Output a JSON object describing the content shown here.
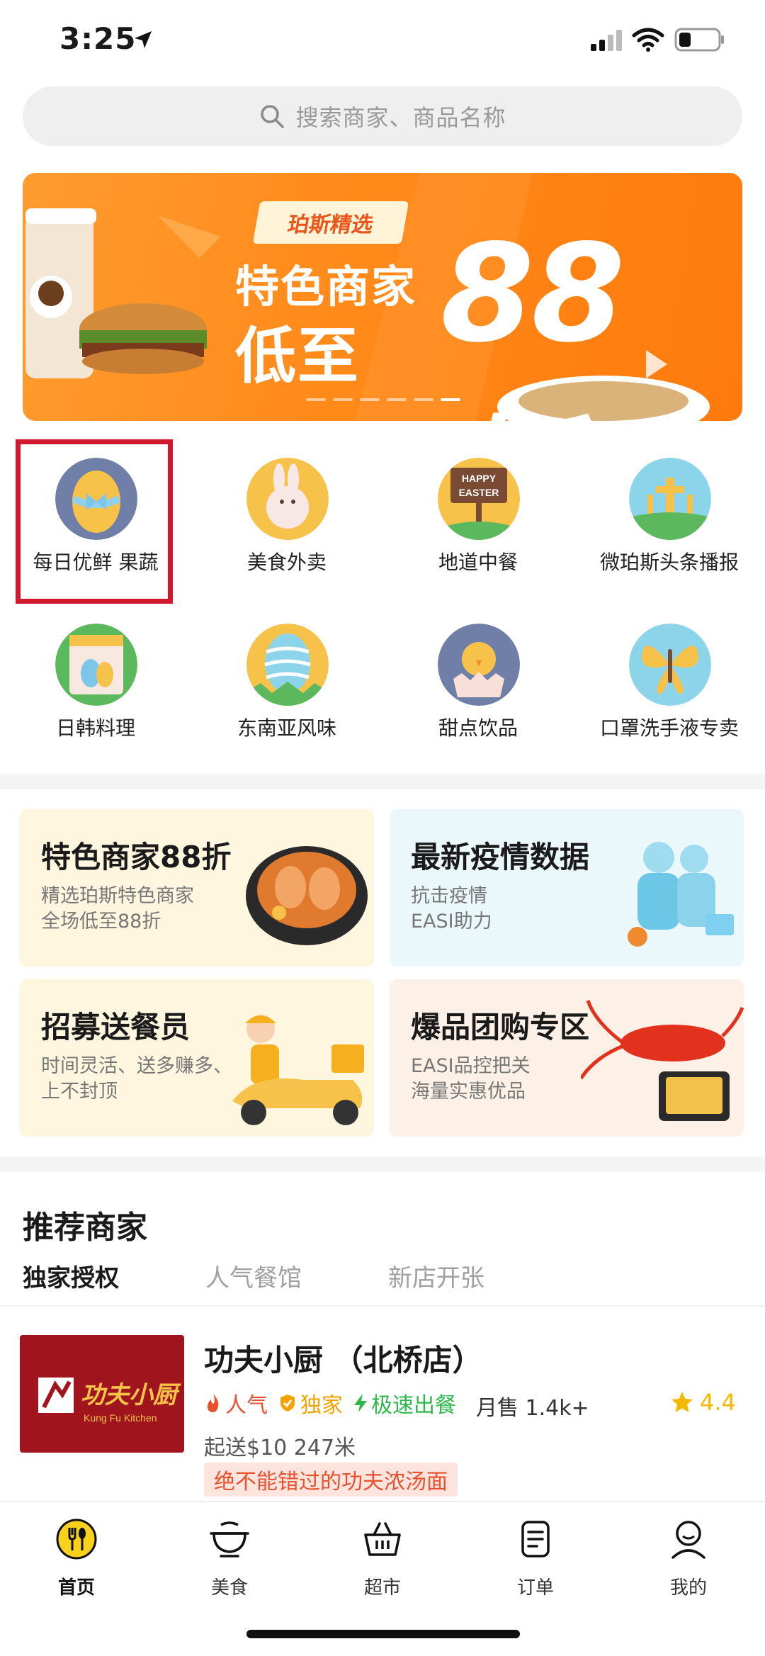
{
  "status_bar": {
    "time": "3:25"
  },
  "search": {
    "placeholder": "搜索商家、商品名称"
  },
  "banner": {
    "tag": "珀斯精选",
    "line1": "特色商家",
    "line2": "低至",
    "big": "88折",
    "page_count": 6,
    "active_page": 6
  },
  "categories": [
    {
      "label": "每日优鲜 果蔬",
      "icon": "easter-egg-bow-icon"
    },
    {
      "label": "美食外卖",
      "icon": "bunny-icon"
    },
    {
      "label": "地道中餐",
      "icon": "happy-easter-sign-icon"
    },
    {
      "label": "微珀斯头条播报",
      "icon": "crosses-icon"
    },
    {
      "label": "日韩料理",
      "icon": "calendar-egg-icon"
    },
    {
      "label": "东南亚风味",
      "icon": "striped-egg-icon"
    },
    {
      "label": "甜点饮品",
      "icon": "chick-icon"
    },
    {
      "label": "口罩洗手液专卖",
      "icon": "butterfly-icon"
    }
  ],
  "cards": [
    {
      "title": "特色商家88折",
      "sub1": "精选珀斯特色商家",
      "sub2": "全场低至88折"
    },
    {
      "title": "最新疫情数据",
      "sub1": "抗击疫情",
      "sub2": "EASI助力"
    },
    {
      "title": "招募送餐员",
      "sub1": "时间灵活、送多赚多、",
      "sub2": "上不封顶"
    },
    {
      "title": "爆品团购专区",
      "sub1": "EASI品控把关",
      "sub2": "海量实惠优品"
    }
  ],
  "recommended": {
    "title": "推荐商家",
    "tabs": [
      "独家授权",
      "人气餐馆",
      "新店开张"
    ],
    "active_tab": 0
  },
  "merchant": {
    "name": "功夫小厨 （北桥店）",
    "logo_text": "功夫小厨",
    "logo_sub": "Kung Fu Kitchen",
    "tags": [
      "人气",
      "独家",
      "极速出餐"
    ],
    "sales": "月售 1.4k+",
    "rating": "4.4",
    "delivery": "起送$10 247米",
    "promo": "绝不能错过的功夫浓汤面"
  },
  "tabbar": [
    {
      "label": "首页",
      "icon": "home-fork-spoon-icon",
      "active": true
    },
    {
      "label": "美食",
      "icon": "bowl-icon",
      "active": false
    },
    {
      "label": "超市",
      "icon": "basket-icon",
      "active": false
    },
    {
      "label": "订单",
      "icon": "order-list-icon",
      "active": false
    },
    {
      "label": "我的",
      "icon": "profile-icon",
      "active": false
    }
  ],
  "colors": {
    "accent_yellow": "#f9d11a",
    "banner_orange": "#ff8a1a",
    "highlight_red": "#d0192f",
    "rating_yellow": "#f5b900",
    "tag_red": "#e8512f",
    "tag_orange": "#f2a300",
    "tag_green": "#2fb84a"
  }
}
